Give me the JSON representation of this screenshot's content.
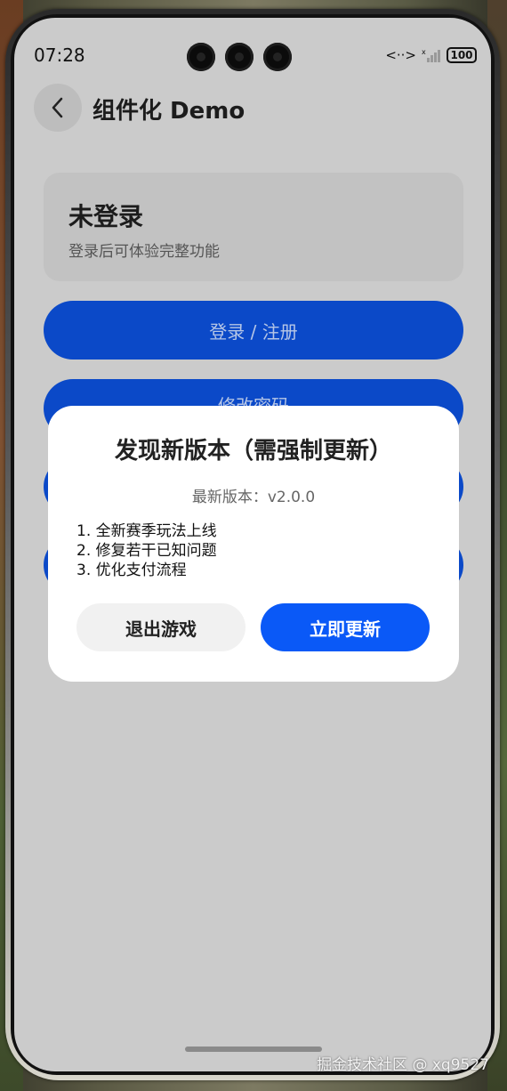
{
  "status_bar": {
    "time": "07:28",
    "signal_icon": "signal-icon",
    "battery": "100"
  },
  "header": {
    "back_icon": "chevron-left-icon",
    "title": "组件化 Demo"
  },
  "login_card": {
    "title": "未登录",
    "subtitle": "登录后可体验完整功能"
  },
  "buttons": {
    "login_register": "登录 / 注册",
    "change_password": "修改密码"
  },
  "update_dialog": {
    "title": "发现新版本（需强制更新）",
    "version": "最新版本：v2.0.0",
    "notes": [
      "1. 全新赛季玩法上线",
      "2. 修复若干已知问题",
      "3. 优化支付流程"
    ],
    "exit_label": "退出游戏",
    "update_label": "立即更新"
  },
  "watermark": "掘金技术社区 @ xq9527",
  "colors": {
    "primary_blue": "#0a59f7",
    "dim_blue": "#0b49c8",
    "screen_bg": "#cbcbcb"
  }
}
